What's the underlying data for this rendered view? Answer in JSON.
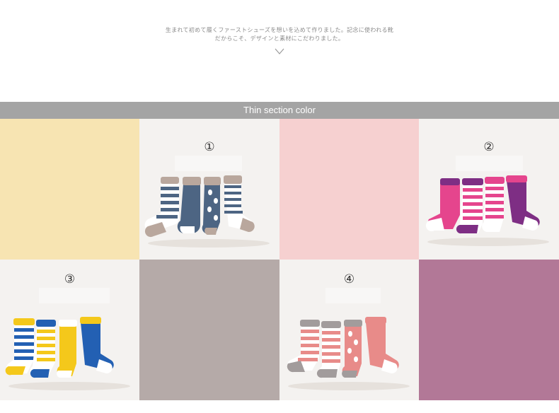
{
  "intro": {
    "line1": "生まれて初めて履くファーストシューズを想いを込めて作りました。記念に使われる靴",
    "line2": "だからこそ、デザインと素材にこだわりました。"
  },
  "section": {
    "title": "Thin section color"
  },
  "colors": {
    "section_bar": "#a4a4a4",
    "swatch_yellow": "#f7e4b2",
    "swatch_pink": "#f6d0d0",
    "swatch_taupe": "#b5aaa8",
    "swatch_purple": "#b27897"
  },
  "products": [
    {
      "number": "①",
      "palette": [
        "#4d6583",
        "#b9a79d",
        "#ffffff"
      ]
    },
    {
      "number": "②",
      "palette": [
        "#e5458d",
        "#7e2e84",
        "#ffffff"
      ]
    },
    {
      "number": "③",
      "palette": [
        "#f4c81b",
        "#2360b3",
        "#ffffff"
      ]
    },
    {
      "number": "④",
      "palette": [
        "#e88b89",
        "#a29c9c",
        "#ffffff"
      ]
    }
  ]
}
